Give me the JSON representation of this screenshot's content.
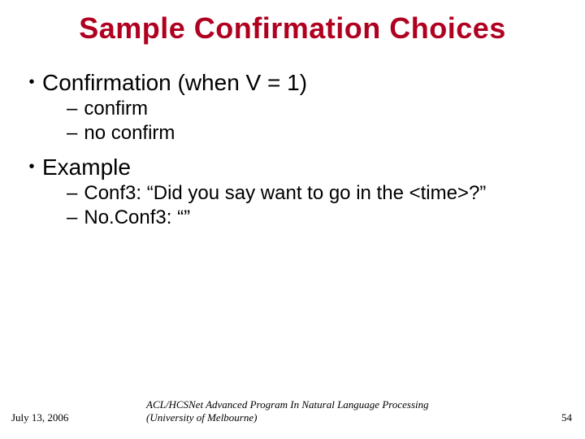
{
  "title": "Sample Confirmation Choices",
  "sections": [
    {
      "heading": "Confirmation (when V = 1)",
      "items": [
        "confirm",
        "no confirm"
      ]
    },
    {
      "heading": "Example",
      "items": [
        "Conf3: “Did you say want to go in the <time>?”",
        "No.Conf3: “”"
      ]
    }
  ],
  "footer": {
    "date": "July 13, 2006",
    "center": "ACL/HCSNet Advanced Program In Natural Language Processing (University of Melbourne)",
    "page": "54"
  }
}
